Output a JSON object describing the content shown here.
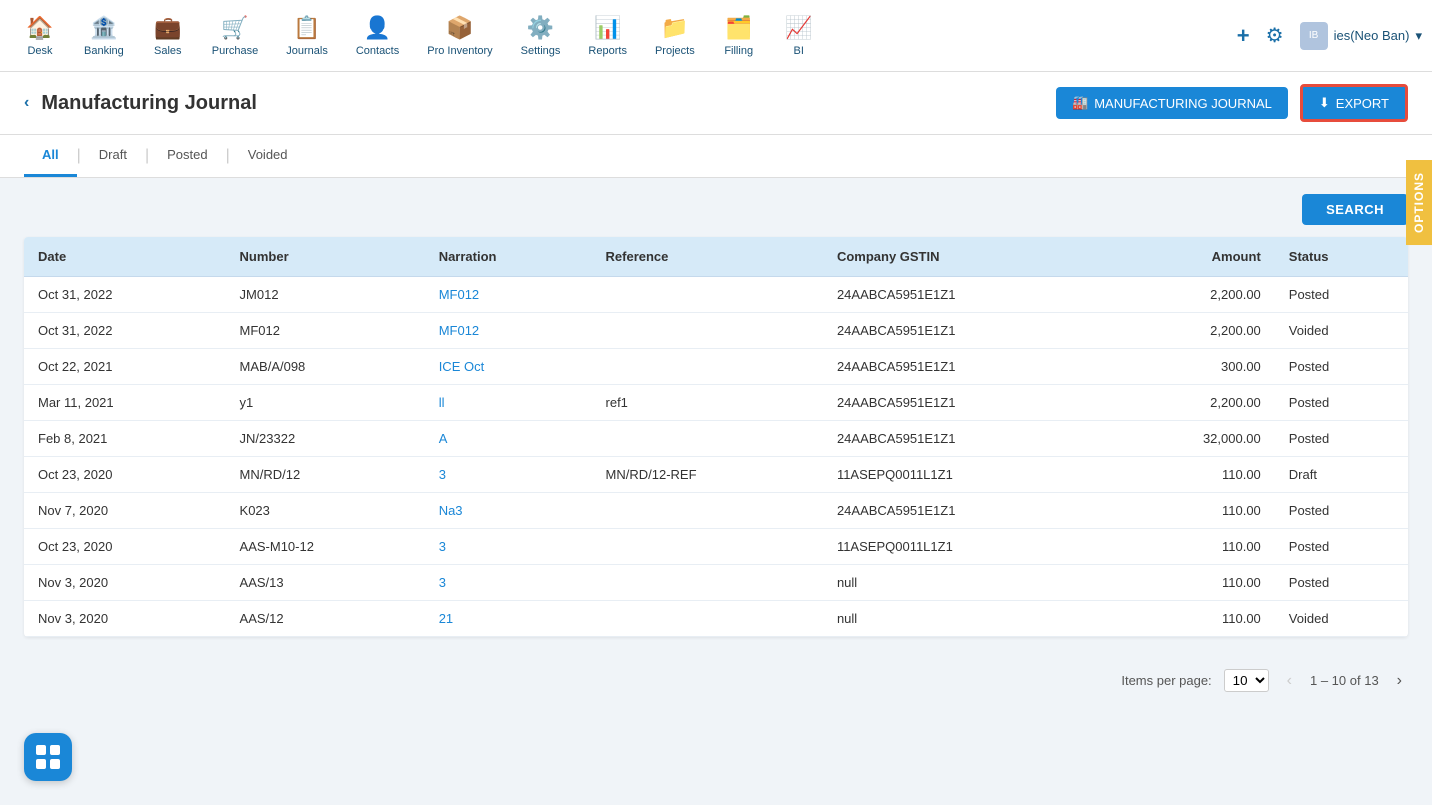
{
  "nav": {
    "items": [
      {
        "id": "desk",
        "label": "Desk",
        "icon": "🏠"
      },
      {
        "id": "banking",
        "label": "Banking",
        "icon": "🏦"
      },
      {
        "id": "sales",
        "label": "Sales",
        "icon": "💼"
      },
      {
        "id": "purchase",
        "label": "Purchase",
        "icon": "🛒"
      },
      {
        "id": "journals",
        "label": "Journals",
        "icon": "📋"
      },
      {
        "id": "contacts",
        "label": "Contacts",
        "icon": "👤"
      },
      {
        "id": "pro-inventory",
        "label": "Pro Inventory",
        "icon": "📦"
      },
      {
        "id": "settings",
        "label": "Settings",
        "icon": "⚙️"
      },
      {
        "id": "reports",
        "label": "Reports",
        "icon": "📊"
      },
      {
        "id": "projects",
        "label": "Projects",
        "icon": "📁"
      },
      {
        "id": "filling",
        "label": "Filling",
        "icon": "🗂️"
      },
      {
        "id": "bi",
        "label": "BI",
        "icon": "📈"
      }
    ],
    "user": "ies(Neo Ban)",
    "plus_icon": "+",
    "gear_icon": "⚙"
  },
  "page": {
    "title": "Manufacturing Journal",
    "back_label": "‹",
    "mfg_journal_btn": "MANUFACTURING JOURNAL",
    "export_btn": "EXPORT",
    "options_label": "OPTIONS"
  },
  "filter_tabs": [
    {
      "id": "all",
      "label": "All",
      "active": true
    },
    {
      "id": "draft",
      "label": "Draft",
      "active": false
    },
    {
      "id": "posted",
      "label": "Posted",
      "active": false
    },
    {
      "id": "voided",
      "label": "Voided",
      "active": false
    }
  ],
  "search": {
    "button_label": "SEARCH"
  },
  "table": {
    "columns": [
      {
        "id": "date",
        "label": "Date",
        "align": "left"
      },
      {
        "id": "number",
        "label": "Number",
        "align": "left"
      },
      {
        "id": "narration",
        "label": "Narration",
        "align": "left"
      },
      {
        "id": "reference",
        "label": "Reference",
        "align": "left"
      },
      {
        "id": "company_gstin",
        "label": "Company GSTIN",
        "align": "left"
      },
      {
        "id": "amount",
        "label": "Amount",
        "align": "right"
      },
      {
        "id": "status",
        "label": "Status",
        "align": "left"
      }
    ],
    "rows": [
      {
        "date": "Oct 31, 2022",
        "number": "JM012",
        "narration": "MF012",
        "narration_link": true,
        "reference": "",
        "company_gstin": "24AABCA5951E1Z1",
        "amount": "2,200.00",
        "status": "Posted"
      },
      {
        "date": "Oct 31, 2022",
        "number": "MF012",
        "narration": "MF012",
        "narration_link": true,
        "reference": "",
        "company_gstin": "24AABCA5951E1Z1",
        "amount": "2,200.00",
        "status": "Voided"
      },
      {
        "date": "Oct 22, 2021",
        "number": "MAB/A/098",
        "narration": "ICE Oct",
        "narration_link": true,
        "reference": "",
        "company_gstin": "24AABCA5951E1Z1",
        "amount": "300.00",
        "status": "Posted"
      },
      {
        "date": "Mar 11, 2021",
        "number": "y1",
        "narration": "ll",
        "narration_link": true,
        "reference": "ref1",
        "company_gstin": "24AABCA5951E1Z1",
        "amount": "2,200.00",
        "status": "Posted"
      },
      {
        "date": "Feb 8, 2021",
        "number": "JN/23322",
        "narration": "A",
        "narration_link": true,
        "reference": "",
        "company_gstin": "24AABCA5951E1Z1",
        "amount": "32,000.00",
        "status": "Posted"
      },
      {
        "date": "Oct 23, 2020",
        "number": "MN/RD/12",
        "narration": "3",
        "narration_link": true,
        "reference": "MN/RD/12-REF",
        "company_gstin": "11ASEPQ0011L1Z1",
        "amount": "110.00",
        "status": "Draft"
      },
      {
        "date": "Nov 7, 2020",
        "number": "K023",
        "narration": "Na3",
        "narration_link": true,
        "reference": "",
        "company_gstin": "24AABCA5951E1Z1",
        "amount": "110.00",
        "status": "Posted"
      },
      {
        "date": "Oct 23, 2020",
        "number": "AAS-M10-12",
        "narration": "3",
        "narration_link": true,
        "reference": "",
        "company_gstin": "11ASEPQ0011L1Z1",
        "amount": "110.00",
        "status": "Posted"
      },
      {
        "date": "Nov 3, 2020",
        "number": "AAS/13",
        "narration": "3",
        "narration_link": true,
        "reference": "",
        "company_gstin": "null",
        "amount": "110.00",
        "status": "Posted"
      },
      {
        "date": "Nov 3, 2020",
        "number": "AAS/12",
        "narration": "21",
        "narration_link": true,
        "reference": "",
        "company_gstin": "null",
        "amount": "110.00",
        "status": "Voided"
      }
    ]
  },
  "pagination": {
    "items_per_page_label": "Items per page:",
    "items_per_page": "10",
    "range_label": "1 – 10 of 13"
  }
}
